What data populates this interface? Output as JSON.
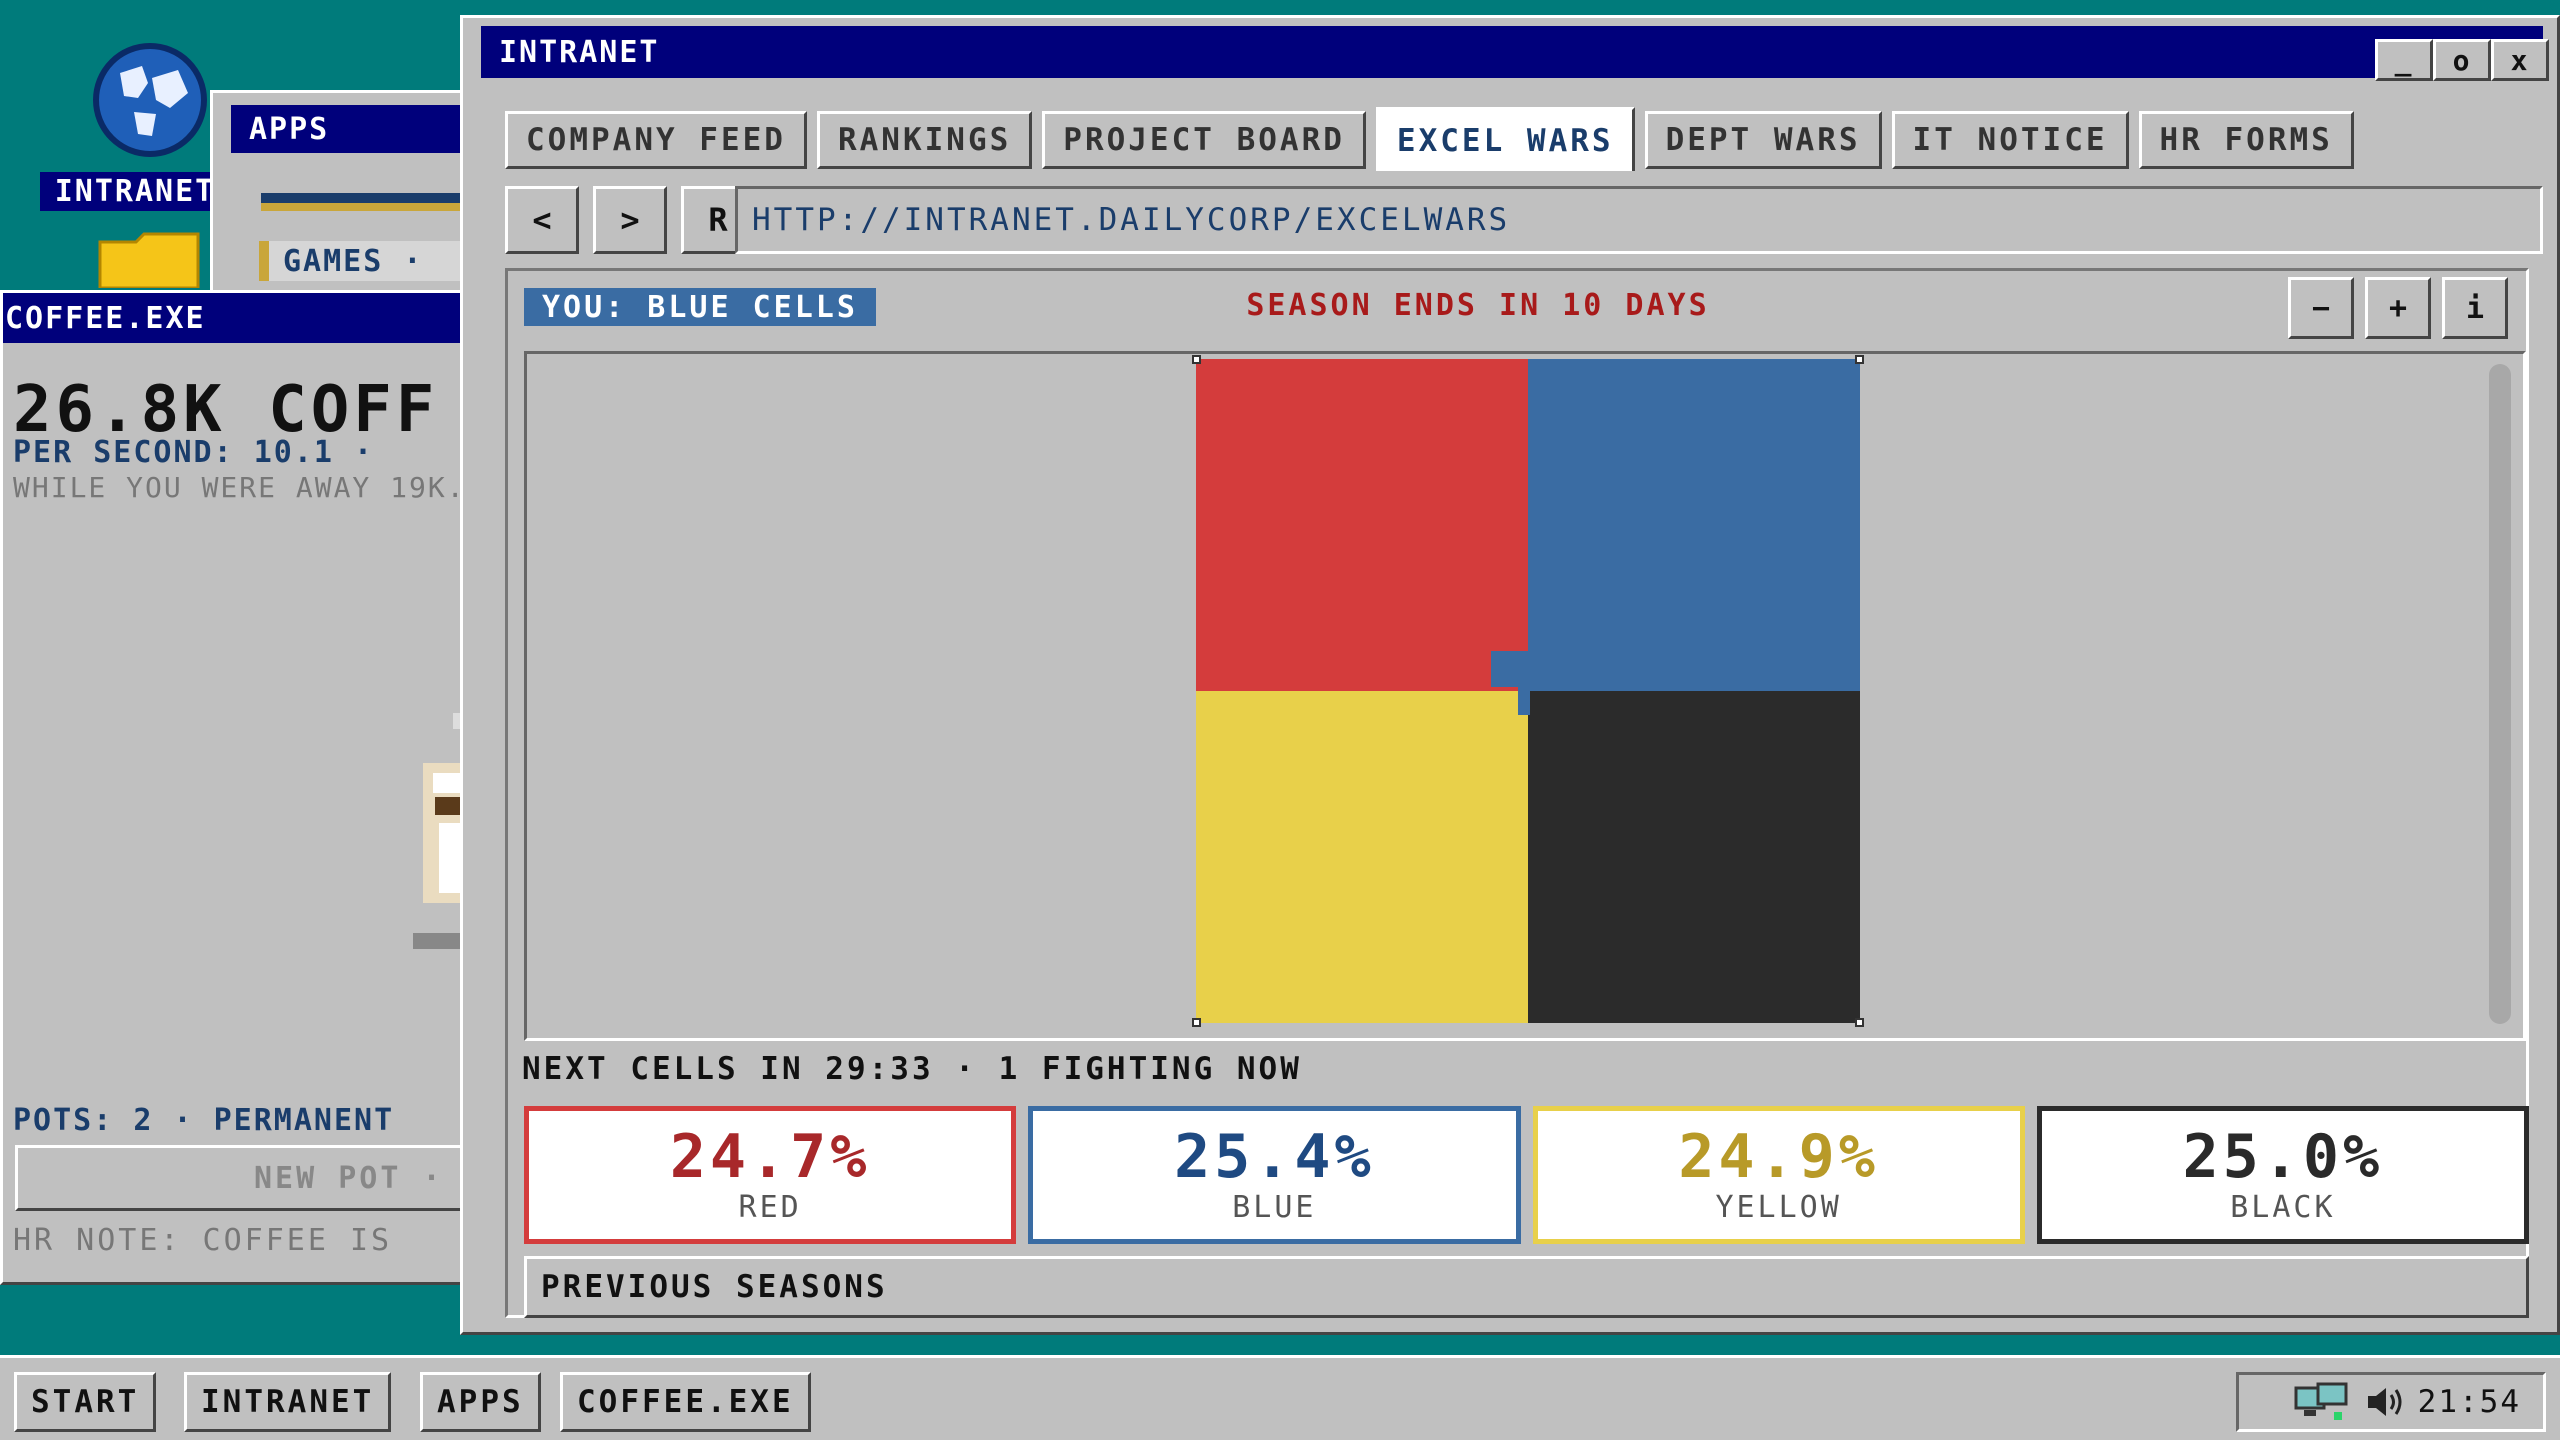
{
  "desktop": {
    "icons": [
      {
        "label": "INTRANET",
        "icon": "globe-icon"
      },
      {
        "label": "",
        "icon": "folder-icon"
      }
    ]
  },
  "apps_window": {
    "title": "APPS",
    "games_label": "GAMES ·"
  },
  "coffee_window": {
    "title": "COFFEE.EXE",
    "big_count": "26.8K COFF",
    "rate": "PER SECOND: 10.1 ·",
    "away": "WHILE YOU WERE AWAY 19K.",
    "pots": "POTS: 2 · PERMANENT",
    "new_pot": "NEW POT ·",
    "hr_note": "HR NOTE: COFFEE IS"
  },
  "intranet_window": {
    "title": "INTRANET",
    "window_buttons": {
      "minimize": "_",
      "maximize": "o",
      "close": "x"
    },
    "tabs": [
      {
        "label": "COMPANY FEED",
        "active": false
      },
      {
        "label": "RANKINGS",
        "active": false
      },
      {
        "label": "PROJECT BOARD",
        "active": false
      },
      {
        "label": "EXCEL WARS",
        "active": true
      },
      {
        "label": "DEPT WARS",
        "active": false
      },
      {
        "label": "IT NOTICE",
        "active": false
      },
      {
        "label": "HR FORMS",
        "active": false
      }
    ],
    "nav": {
      "back": "<",
      "forward": ">",
      "refresh": "R",
      "url": "HTTP://INTRANET.DAILYCORP/EXCELWARS"
    },
    "excel_wars": {
      "you_badge": "YOU: BLUE CELLS",
      "season": "SEASON ENDS IN 10 DAYS",
      "zoom": {
        "out": "−",
        "in": "+",
        "info": "i"
      },
      "next_cells": "NEXT CELLS IN 29:33 · 1 FIGHTING NOW",
      "teams": [
        {
          "pct": "24.7%",
          "name": "RED",
          "color": "#a8282a",
          "fill": "#d43c3c"
        },
        {
          "pct": "25.4%",
          "name": "BLUE",
          "color": "#1f4a82",
          "fill": "#3a6ca3"
        },
        {
          "pct": "24.9%",
          "name": "YELLOW",
          "color": "#b89a28",
          "fill": "#e8d04a"
        },
        {
          "pct": "25.0%",
          "name": "BLACK",
          "color": "#2a2a2a",
          "fill": "#2b2b2b"
        }
      ],
      "previous_seasons": "PREVIOUS SEASONS"
    }
  },
  "taskbar": {
    "start": "START",
    "buttons": [
      "INTRANET",
      "APPS",
      "COFFEE.EXE"
    ],
    "clock": "21:54"
  }
}
